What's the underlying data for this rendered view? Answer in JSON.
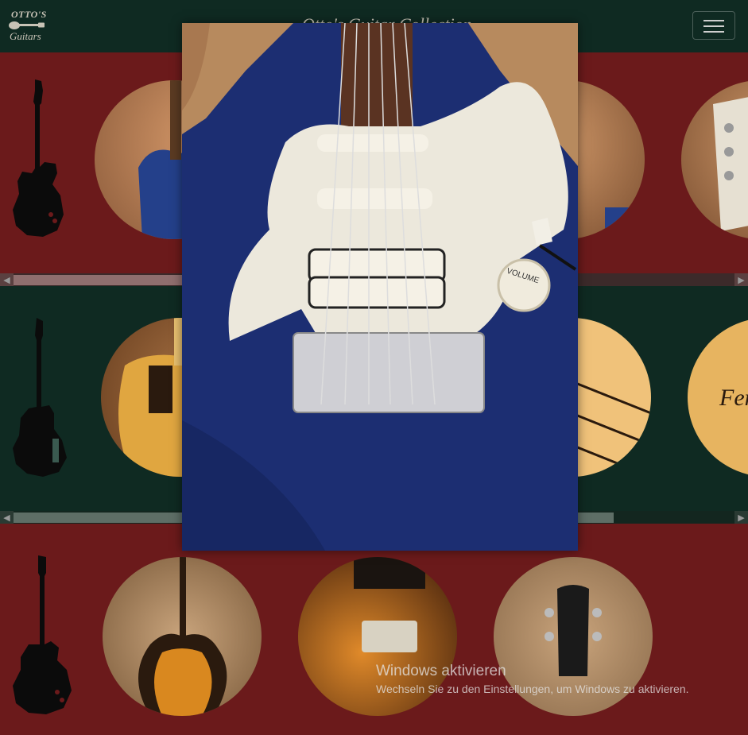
{
  "navbar": {
    "logo_line1": "OTTO'S",
    "logo_line2": "Guitars",
    "title": "Otto's Guitar Collection",
    "menu_toggle_icon": "hamburger-icon"
  },
  "rows": [
    {
      "name": "Stratocaster row",
      "silhouette_icon": "stratocaster-silhouette-icon",
      "photos": [
        "blue-strat-body-photo",
        "strat-neck-photo",
        "strat-headstock-photo"
      ]
    },
    {
      "name": "Telecaster row",
      "silhouette_icon": "telecaster-silhouette-icon",
      "photos": [
        "tele-body-photo",
        "tele-neck-photo",
        "tele-headstock-photo"
      ]
    },
    {
      "name": "Semi-hollow row",
      "silhouette_icon": "semihollow-silhouette-icon",
      "photos": [
        "sunburst-semihollow-photo",
        "semihollow-pickup-photo",
        "epiphone-headstock-photo"
      ]
    }
  ],
  "modal": {
    "image": "blue-stratocaster-body-closeup",
    "knob_label": "VOLUME"
  },
  "watermark": {
    "title": "Windows aktivieren",
    "subtitle": "Wechseln Sie zu den Einstellungen, um Windows zu aktivieren."
  },
  "colors": {
    "red_row": "#6b1a1b",
    "green_row": "#0f2a22",
    "navbar": "#0f2a22",
    "guitar_blue": "#1c2e72",
    "pickguard": "#ece8dc"
  }
}
